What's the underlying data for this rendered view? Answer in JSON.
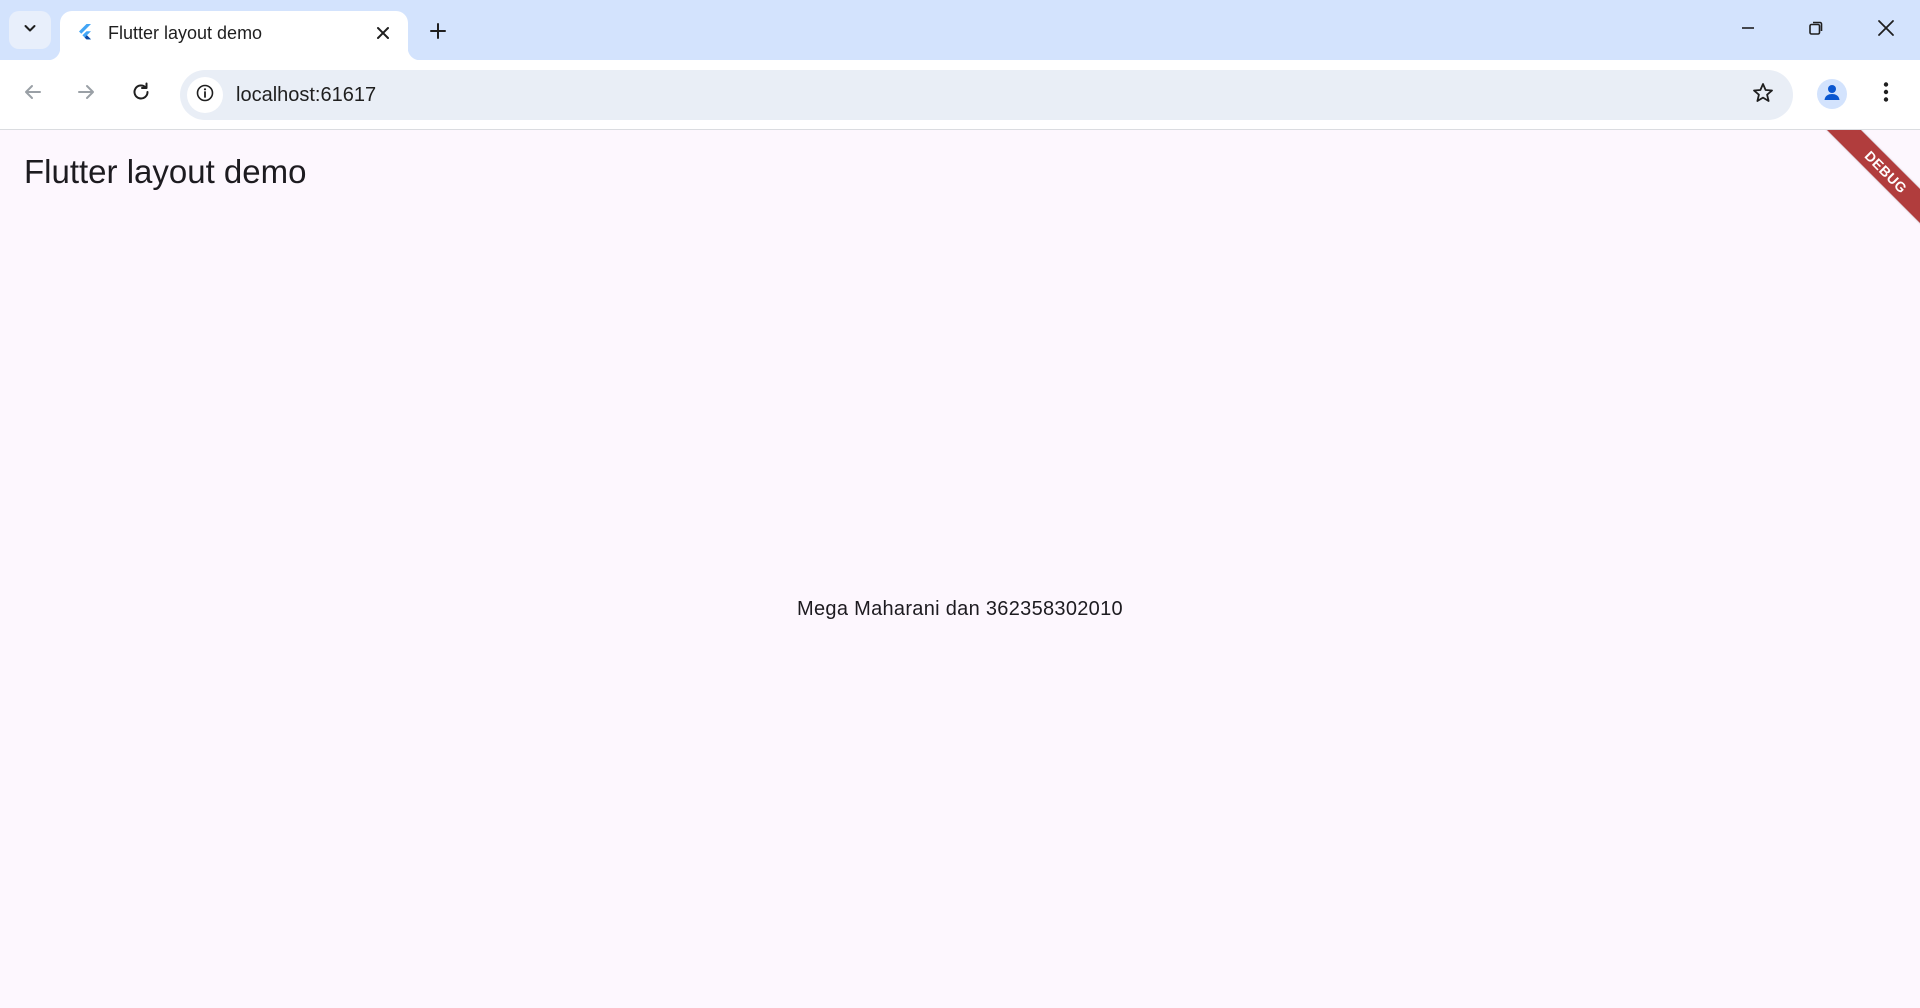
{
  "browser": {
    "tab": {
      "title": "Flutter layout demo",
      "favicon": "flutter-logo-icon"
    },
    "address_bar": {
      "url": "localhost:61617"
    },
    "colors": {
      "tabstrip": "#d3e3fd",
      "omnibox": "#e9eef6",
      "page_background": "#fdf7fe",
      "debug_banner": "#b13d3d"
    }
  },
  "app": {
    "appbar_title": "Flutter layout demo",
    "body_text": "Mega Maharani dan 362358302010",
    "debug_banner": "DEBUG"
  }
}
